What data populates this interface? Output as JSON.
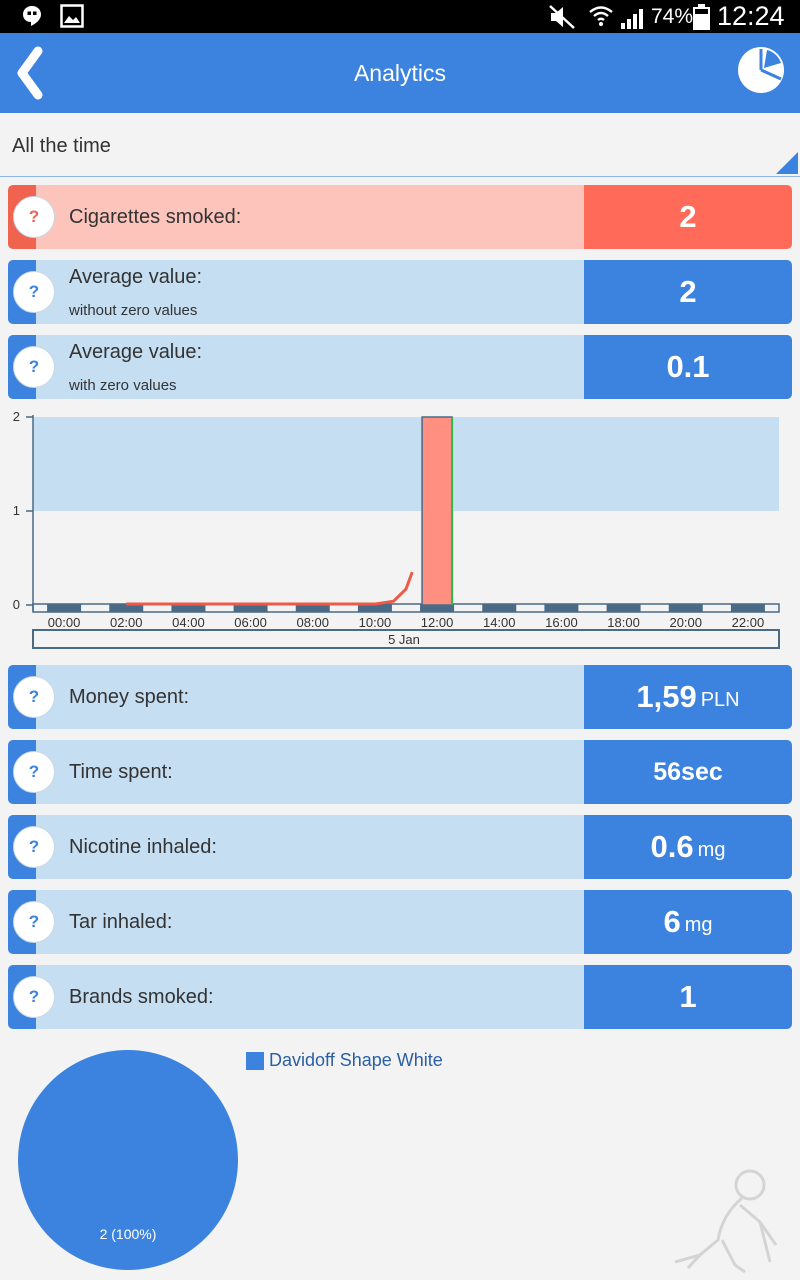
{
  "status_bar": {
    "battery": "74%",
    "time": "12:24",
    "icons": [
      "hangouts-icon",
      "gallery-icon",
      "mute-icon",
      "wifi-icon",
      "signal-icon",
      "battery-icon"
    ]
  },
  "app_bar": {
    "title": "Analytics",
    "back_icon": "chevron-left-icon",
    "action_icon": "pie-chart-icon"
  },
  "period": {
    "selected": "All the time"
  },
  "stats": {
    "cigarettes": {
      "label": "Cigarettes smoked:",
      "value": "2"
    },
    "avg_no_zero": {
      "label": "Average value:",
      "sublabel": "without zero values",
      "value": "2"
    },
    "avg_with_zero": {
      "label": "Average value:",
      "sublabel": "with zero values",
      "value": "0.1"
    },
    "money": {
      "label": "Money spent:",
      "value": "1,59",
      "unit": "PLN"
    },
    "time": {
      "label": "Time spent:",
      "value": "56sec"
    },
    "nicotine": {
      "label": "Nicotine inhaled:",
      "value": "0.6",
      "unit": "mg"
    },
    "tar": {
      "label": "Tar inhaled:",
      "value": "6",
      "unit": "mg"
    },
    "brands": {
      "label": "Brands smoked:",
      "value": "1"
    }
  },
  "help_label": "?",
  "chart_data": [
    {
      "type": "bar",
      "categories": [
        "00:00",
        "02:00",
        "04:00",
        "06:00",
        "08:00",
        "10:00",
        "12:00",
        "14:00",
        "16:00",
        "18:00",
        "20:00",
        "22:00"
      ],
      "values": [
        0,
        0,
        0,
        0,
        0,
        0,
        2,
        0,
        0,
        0,
        0,
        0
      ],
      "yticks": [
        "0",
        "1",
        "2"
      ],
      "ylim": [
        0,
        2
      ],
      "band": [
        1,
        2
      ],
      "date_label": "5 Jan",
      "trend_line": [
        {
          "x": 1,
          "y": 0.01
        },
        {
          "x": 2,
          "y": 0.01
        },
        {
          "x": 3,
          "y": 0.01
        },
        {
          "x": 4,
          "y": 0.01
        },
        {
          "x": 5,
          "y": 0.01
        },
        {
          "x": 5.3,
          "y": 0.04
        },
        {
          "x": 5.5,
          "y": 0.17
        },
        {
          "x": 5.6,
          "y": 0.35
        }
      ],
      "colors": {
        "bar": "#ff8f80",
        "line": "#ef5a48",
        "band": "#c5def2",
        "axis": "#4a6a86"
      }
    },
    {
      "type": "pie",
      "legend": [
        "Davidoff Shape White"
      ],
      "values": [
        2
      ],
      "slice_labels": [
        "2 (100%)"
      ],
      "colors": [
        "#3b83de"
      ]
    }
  ]
}
